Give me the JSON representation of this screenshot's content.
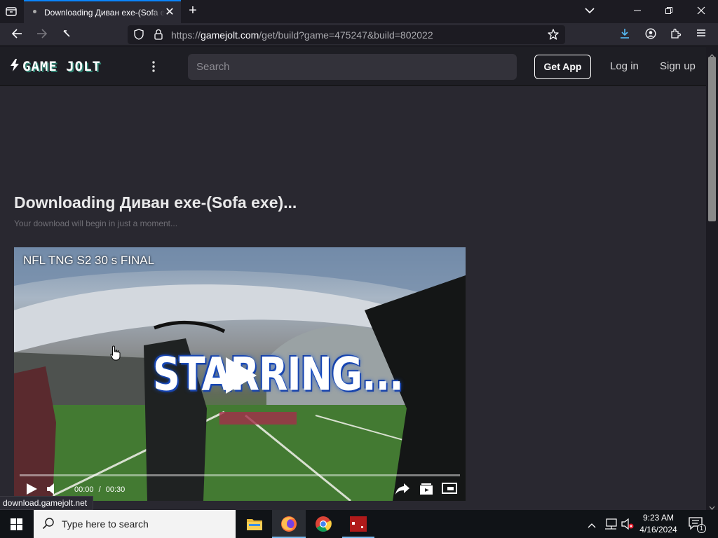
{
  "browser": {
    "tab_title": "Downloading Диван exe-(Sofa exe)...",
    "url_prefix": "https://",
    "url_domain": "gamejolt.com",
    "url_path": "/get/build?game=475247&build=802022"
  },
  "gamejolt": {
    "logo_text": "GAME JOLT",
    "search_placeholder": "Search",
    "get_app_label": "Get App",
    "login_label": "Log in",
    "signup_label": "Sign up"
  },
  "main": {
    "title": "Downloading Диван exe-(Sofa exe)...",
    "subtitle": "Your download will begin in just a moment..."
  },
  "video": {
    "title": "NFL TNG S2 30 s FINAL",
    "overlay_text": "STARRING...",
    "current_time": "00:00",
    "time_separator": "/",
    "duration": "00:30",
    "progress": 0
  },
  "status_bar": {
    "text": "download.gamejolt.net"
  },
  "taskbar": {
    "search_placeholder": "Type here to search",
    "time": "9:23 AM",
    "date": "4/16/2024",
    "notification_count": "1"
  },
  "colors": {
    "accent_blue": "#0a84ff",
    "gamejolt_green": "#ccff00",
    "header_bg": "#1e1e24",
    "page_bg": "#292830"
  }
}
